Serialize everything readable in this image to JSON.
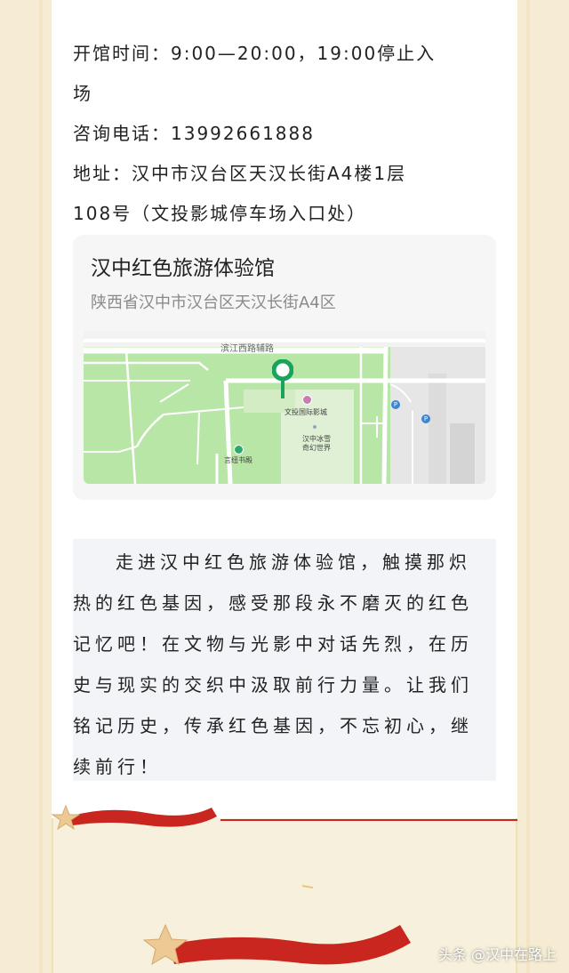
{
  "info": {
    "hours_line1": "开馆时间：9:00—20:00，19:00停止入",
    "hours_line2": "场",
    "phone": "咨询电话：13992661888",
    "address_line1": "地址：汉中市汉台区天汉长街A4楼1层",
    "address_line2": "108号（文投影城停车场入口处）"
  },
  "map_card": {
    "title": "汉中红色旅游体验馆",
    "subtitle": "陕西省汉中市汉台区天汉长街A4区",
    "labels": {
      "road": "滨江西路辅路",
      "cinema": "文投国际影城",
      "ice_line1": "汉中冰雪",
      "ice_line2": "奇幻世界",
      "bookstore": "言纽书殿"
    },
    "icons": {
      "pin": "location-pin-icon",
      "parking": "parking-icon",
      "cinema": "cinema-poi-icon",
      "bookstore": "bookstore-poi-icon"
    }
  },
  "quote": {
    "lines": [
      "走进汉中红色旅游体验馆，触摸那炽",
      "热的红色基因，感受那段永不磨灭的红色",
      "记忆吧！在文物与光影中对话先烈，在历",
      "史与现实的交织中汲取前行力量。让我们",
      "铭记历史，传承红色基因，不忘初心，继",
      "续前行！"
    ]
  },
  "watermark": "头条 @汉中在路上",
  "colors": {
    "background": "#f7f0dc",
    "ribbon_red": "#c8261e",
    "star_gold": "#e9c28a",
    "map_green": "#b7e6a4",
    "pin_green": "#1aa35a"
  }
}
